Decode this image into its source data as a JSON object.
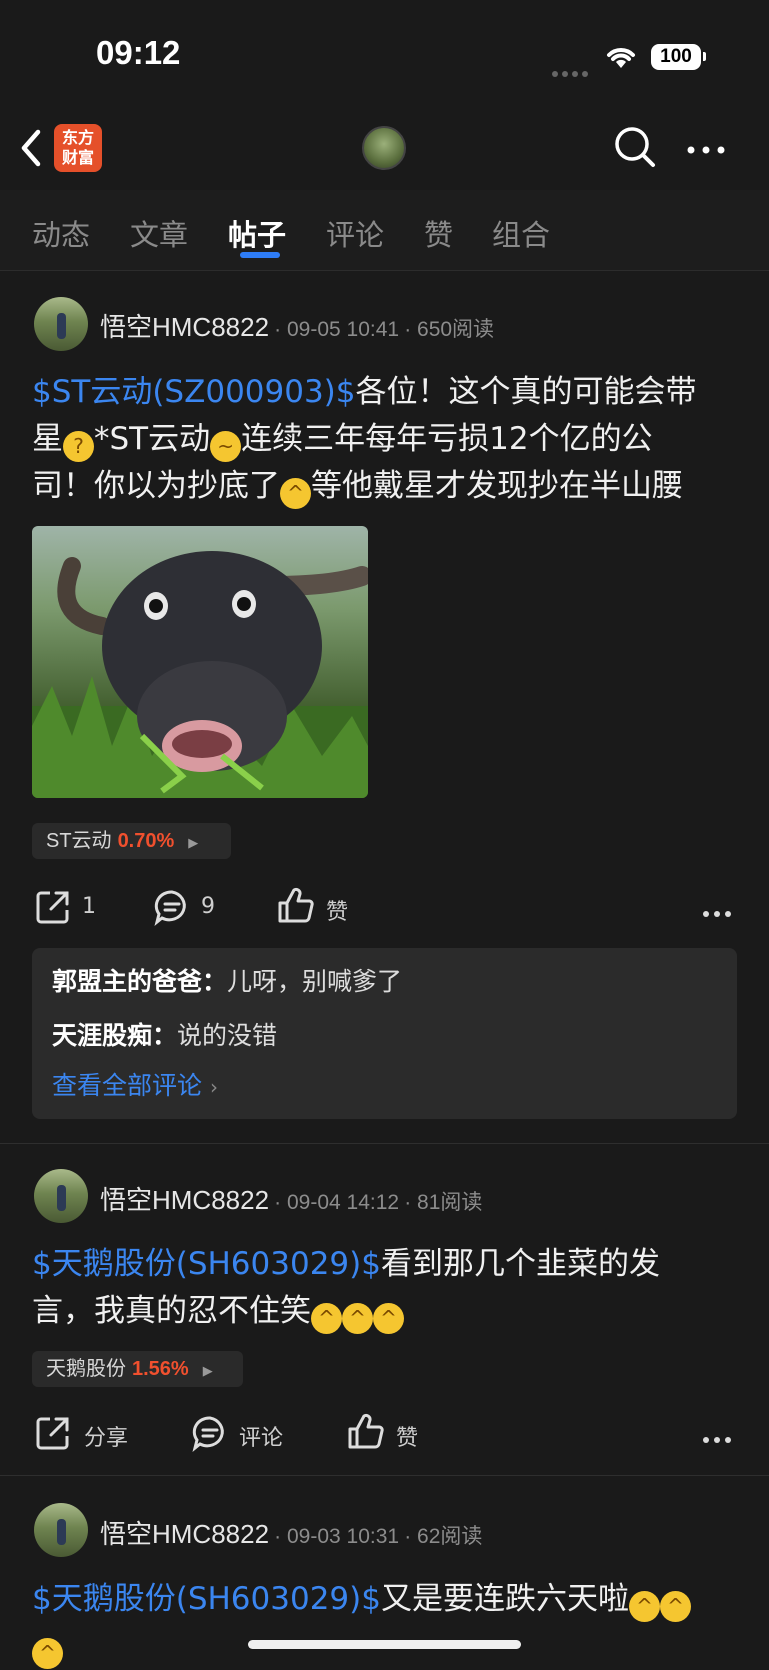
{
  "status": {
    "time": "09:12",
    "battery": "100"
  },
  "nav": {
    "logo_line1": "东方",
    "logo_line2": "财富"
  },
  "tabs": [
    "动态",
    "文章",
    "帖子",
    "评论",
    "赞",
    "组合"
  ],
  "active_tab": "帖子",
  "posts": [
    {
      "username": "悟空HMC8822",
      "date": "09-05 10:41",
      "reads": "650阅读",
      "tag": "$ST云动(SZ000903)$",
      "text1": "各位！这个真的可能会带",
      "text2": "星",
      "text3": "*ST云动",
      "text4": "连续三年每年亏损12个亿的公",
      "text5": "司！你以为抄底了",
      "text6": "等他戴星才发现抄在半山腰",
      "stock": {
        "name": "ST云动",
        "pct": "0.70%"
      },
      "actions": {
        "share": "1",
        "comment": "9",
        "like": "赞"
      },
      "comments": [
        {
          "author": "郭盟主的爸爸：",
          "text": "儿呀，别喊爹了"
        },
        {
          "author": "天涯股痴：",
          "text": "说的没错"
        }
      ],
      "view_all": "查看全部评论"
    },
    {
      "username": "悟空HMC8822",
      "date": "09-04 14:12",
      "reads": "81阅读",
      "tag": "$天鹅股份(SH603029)$",
      "text1": "看到那几个韭菜的发",
      "text2": "言，我真的忍不住笑",
      "stock": {
        "name": "天鹅股份",
        "pct": "1.56%"
      },
      "actions": {
        "share": "分享",
        "comment": "评论",
        "like": "赞"
      }
    },
    {
      "username": "悟空HMC8822",
      "date": "09-03 10:31",
      "reads": "62阅读",
      "tag": "$天鹅股份(SH603029)$",
      "text1": "又是要连跌六天啦"
    }
  ]
}
